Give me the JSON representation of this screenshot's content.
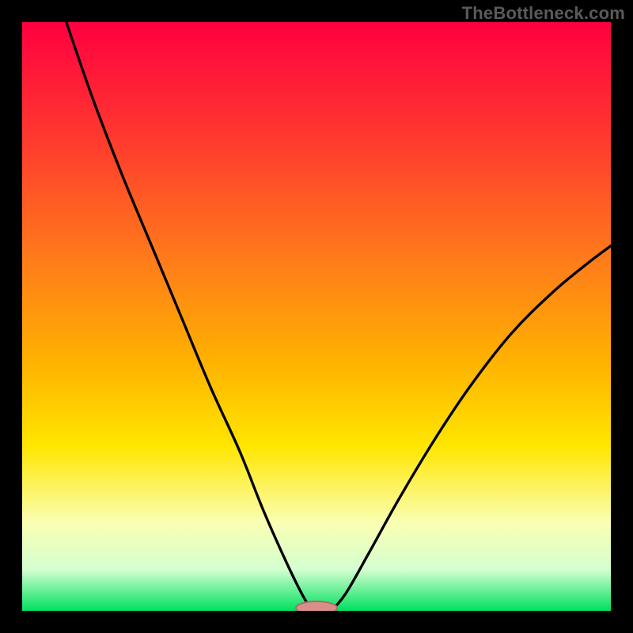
{
  "watermark": "TheBottleneck.com",
  "colors": {
    "background": "#000000",
    "curve": "#000000",
    "marker_fill": "#d98e88",
    "marker_stroke": "#a86e6a",
    "gradient_stops": [
      {
        "offset": 0.0,
        "color": "#ff0040"
      },
      {
        "offset": 0.2,
        "color": "#ff3a2e"
      },
      {
        "offset": 0.4,
        "color": "#ff7a1a"
      },
      {
        "offset": 0.58,
        "color": "#ffb300"
      },
      {
        "offset": 0.72,
        "color": "#ffe600"
      },
      {
        "offset": 0.85,
        "color": "#faffb3"
      },
      {
        "offset": 0.93,
        "color": "#d4ffd0"
      },
      {
        "offset": 1.0,
        "color": "#00e060"
      }
    ]
  },
  "chart_data": {
    "type": "line",
    "title": "",
    "xlabel": "",
    "ylabel": "",
    "xlim": [
      0,
      100
    ],
    "ylim": [
      0,
      100
    ],
    "optimum_x": 50,
    "left_curve": [
      {
        "x": 7.5,
        "y": 100
      },
      {
        "x": 12,
        "y": 87
      },
      {
        "x": 17,
        "y": 74
      },
      {
        "x": 22,
        "y": 62
      },
      {
        "x": 27,
        "y": 50
      },
      {
        "x": 32,
        "y": 38
      },
      {
        "x": 37,
        "y": 27
      },
      {
        "x": 41,
        "y": 17
      },
      {
        "x": 45,
        "y": 8
      },
      {
        "x": 48,
        "y": 2
      },
      {
        "x": 49.5,
        "y": 0
      }
    ],
    "right_curve": [
      {
        "x": 52.5,
        "y": 0
      },
      {
        "x": 55,
        "y": 3
      },
      {
        "x": 59,
        "y": 10
      },
      {
        "x": 64,
        "y": 19
      },
      {
        "x": 70,
        "y": 29
      },
      {
        "x": 76,
        "y": 38
      },
      {
        "x": 83,
        "y": 47
      },
      {
        "x": 90,
        "y": 54
      },
      {
        "x": 96,
        "y": 59
      },
      {
        "x": 100,
        "y": 62
      }
    ],
    "marker": {
      "x": 50,
      "y": 0,
      "rx": 3.5,
      "ry": 1.1
    }
  }
}
